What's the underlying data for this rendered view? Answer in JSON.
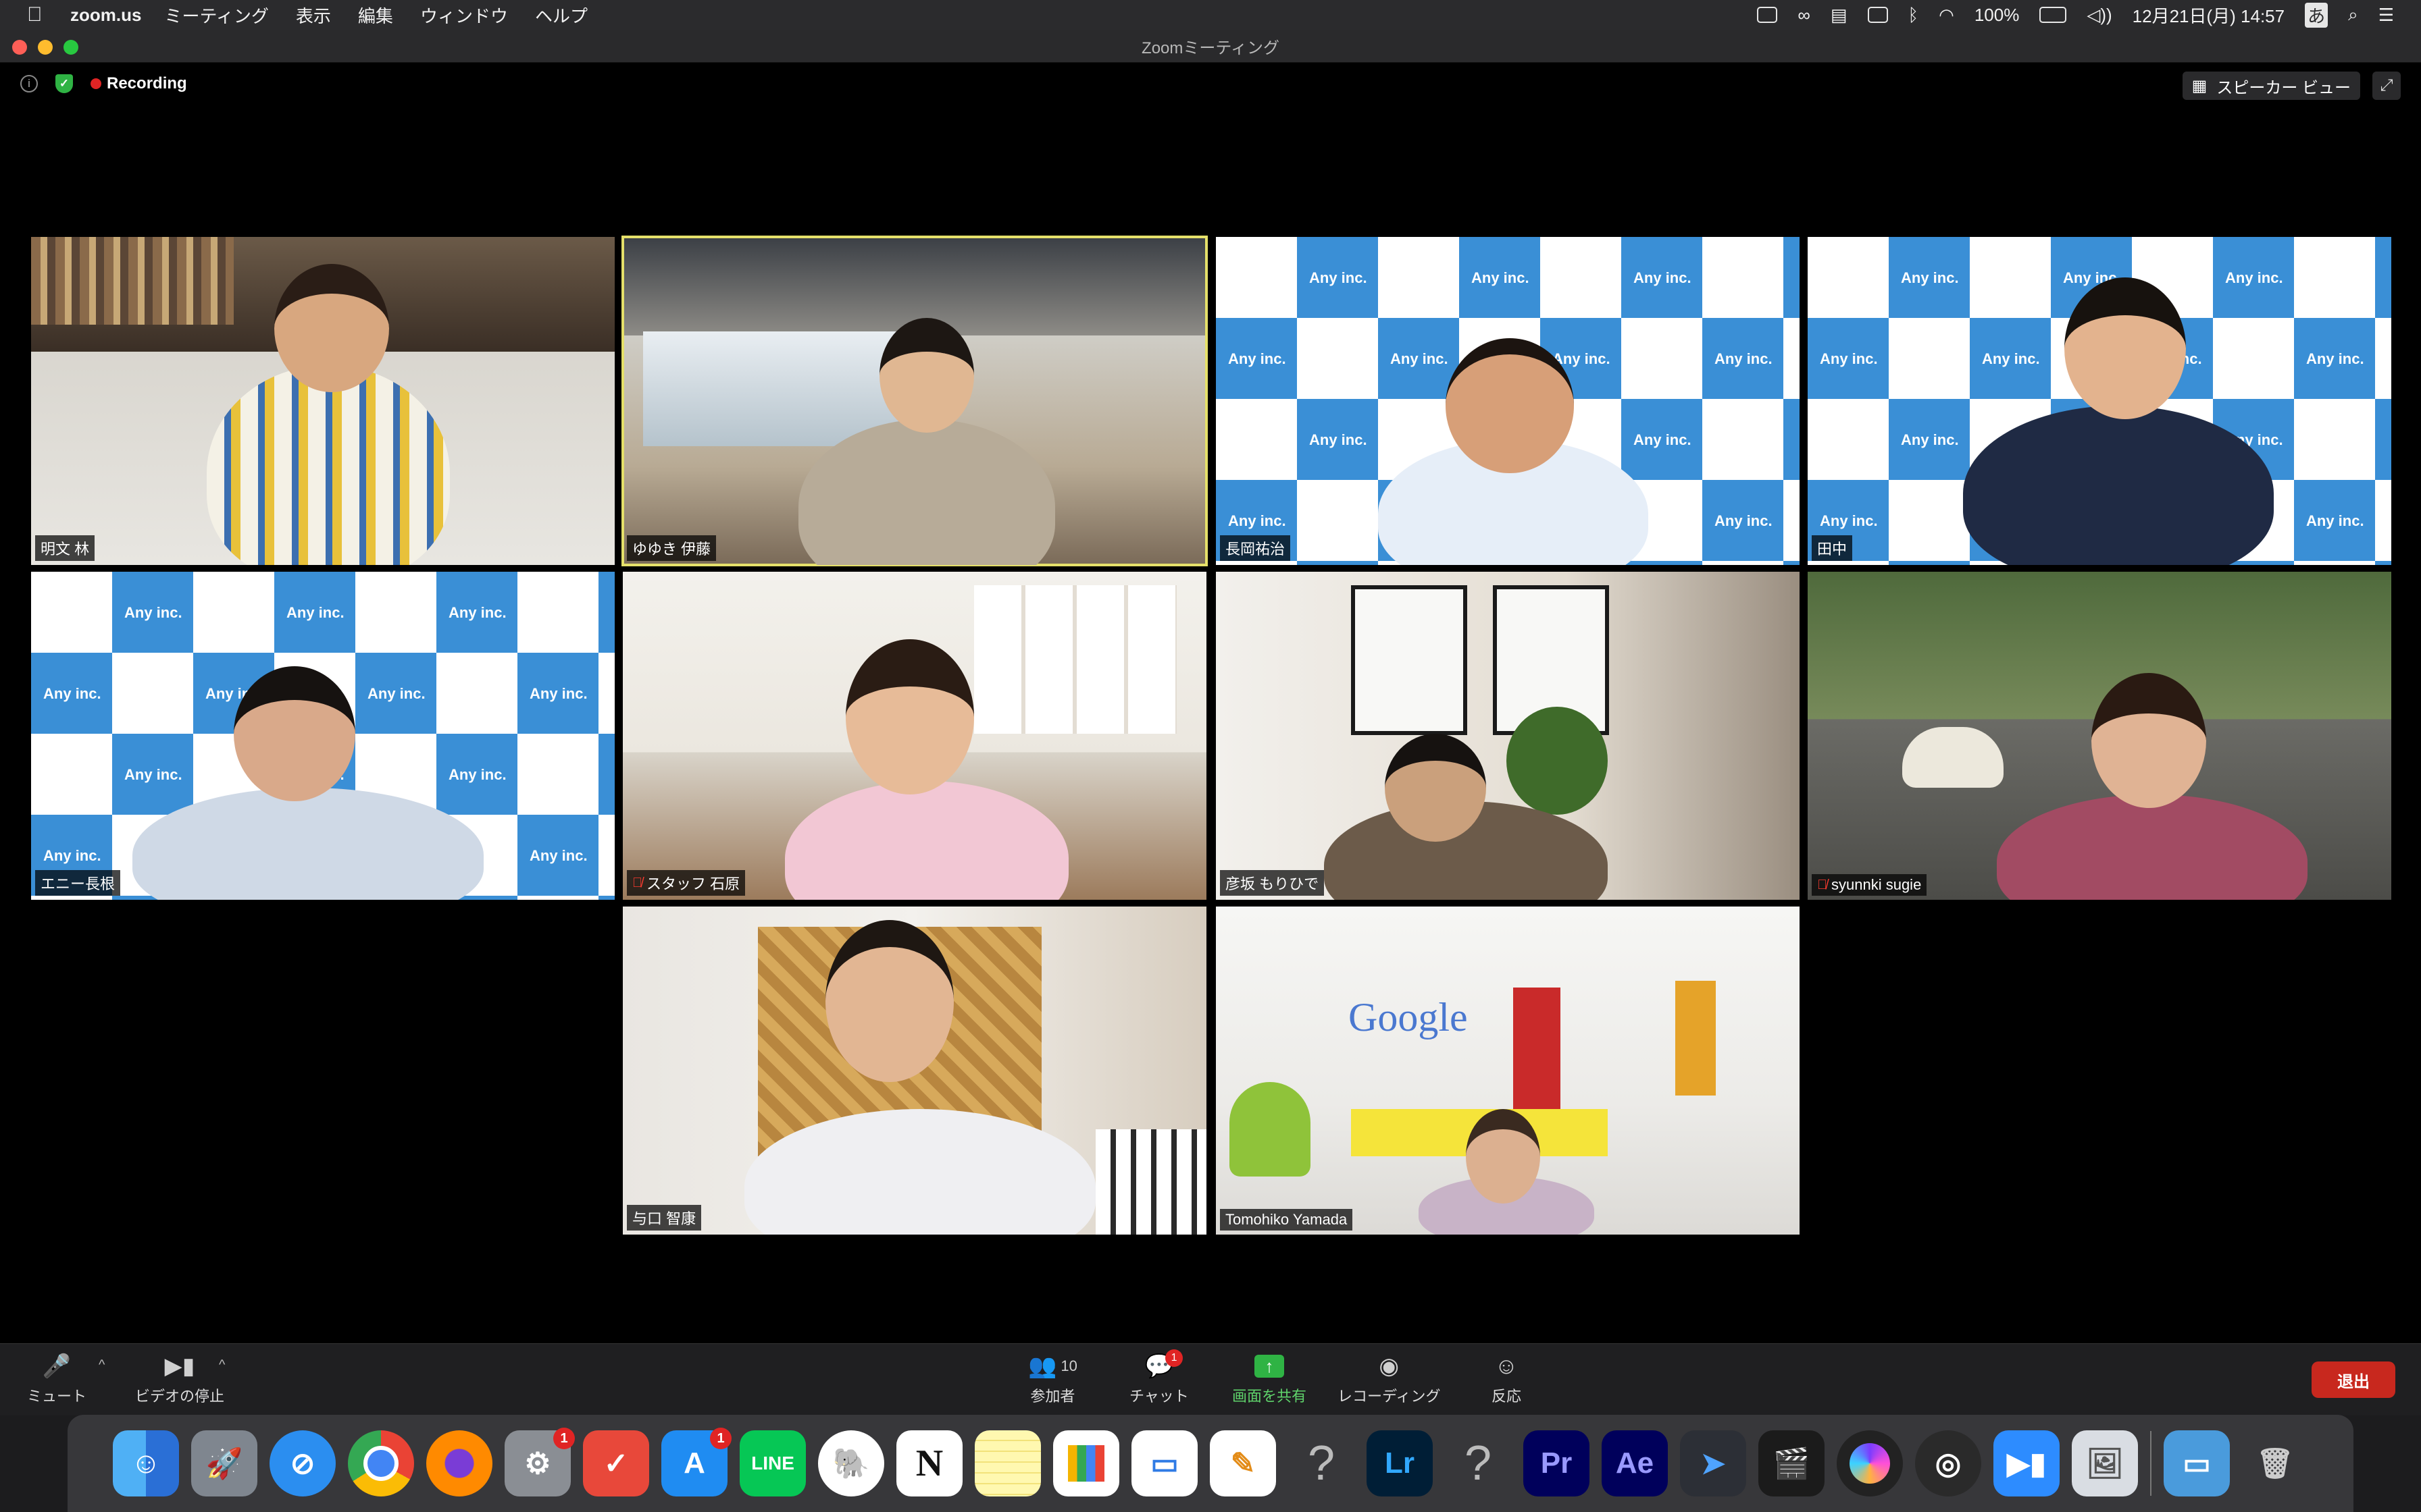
{
  "menubar": {
    "app": "zoom.us",
    "menus": [
      "ミーティング",
      "表示",
      "編集",
      "ウィンドウ",
      "ヘルプ"
    ],
    "battery": "100%",
    "datetime": "12月21日(月) 14:57",
    "input_method": "あ"
  },
  "window": {
    "title": "Zoomミーティング",
    "recording_label": "Recording",
    "view_label": "スピーカー ビュー"
  },
  "participants": [
    {
      "name": "明文 林",
      "muted": false
    },
    {
      "name": "ゆゆき 伊藤",
      "muted": false,
      "active_speaker": true
    },
    {
      "name": "長岡祐治",
      "muted": false
    },
    {
      "name": "田中",
      "muted": false
    },
    {
      "name": "エニー長根",
      "muted": false
    },
    {
      "name": "スタッフ 石原",
      "muted": true
    },
    {
      "name": "彦坂 もりひで",
      "muted": false
    },
    {
      "name": "syunnki sugie",
      "muted": true
    },
    {
      "name": "与口 智康",
      "muted": false
    },
    {
      "name": "Tomohiko Yamada",
      "muted": false
    }
  ],
  "backgrounds": {
    "any_text": "Any inc.",
    "google_text": "Google"
  },
  "toolbar": {
    "mute_label": "ミュート",
    "video_label": "ビデオの停止",
    "participants_label": "参加者",
    "participants_count": "10",
    "chat_label": "チャット",
    "chat_badge": "1",
    "share_label": "画面を共有",
    "record_label": "レコーディング",
    "reactions_label": "反応",
    "leave_label": "退出"
  },
  "dock": {
    "badges": {
      "settings": "1",
      "appstore": "1"
    },
    "line_label": "LINE",
    "notion_label": "N",
    "lr_label": "Lr",
    "pr_label": "Pr",
    "ae_label": "Ae"
  },
  "colors": {
    "active_border": "#e5e06a",
    "leave_button": "#c8281e",
    "share_green": "#2fb344",
    "recording_red": "#e02424"
  }
}
